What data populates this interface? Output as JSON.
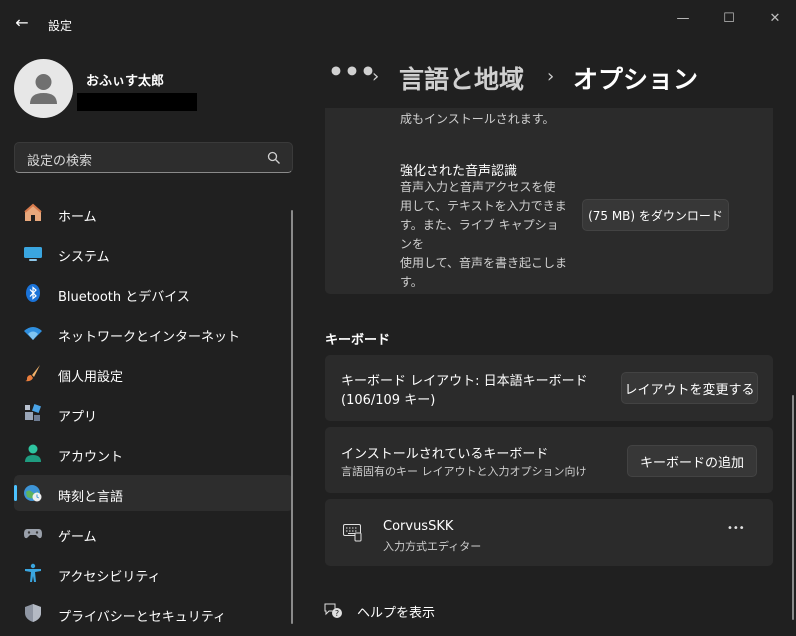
{
  "window": {
    "title": "設定",
    "back_glyph": "←",
    "minimize_glyph": "—",
    "maximize_glyph": "☐",
    "close_glyph": "✕"
  },
  "profile": {
    "name": "おふぃす太郎"
  },
  "search": {
    "placeholder": "設定の検索"
  },
  "sidebar": {
    "items": [
      {
        "label": "ホーム",
        "icon": "home-icon"
      },
      {
        "label": "システム",
        "icon": "system-icon"
      },
      {
        "label": "Bluetooth とデバイス",
        "icon": "bluetooth-icon"
      },
      {
        "label": "ネットワークとインターネット",
        "icon": "wifi-icon"
      },
      {
        "label": "個人用設定",
        "icon": "brush-icon"
      },
      {
        "label": "アプリ",
        "icon": "apps-icon"
      },
      {
        "label": "アカウント",
        "icon": "account-icon"
      },
      {
        "label": "時刻と言語",
        "icon": "time-language-icon",
        "selected": true
      },
      {
        "label": "ゲーム",
        "icon": "gamepad-icon"
      },
      {
        "label": "アクセシビリティ",
        "icon": "accessibility-icon"
      },
      {
        "label": "プライバシーとセキュリティ",
        "icon": "shield-icon"
      }
    ]
  },
  "breadcrumb": {
    "more": "•••",
    "sep": "›",
    "parent": "言語と地域",
    "current": "オプション"
  },
  "content": {
    "top_partial_text": "成もインストールされます。",
    "speech": {
      "title": "強化された音声認識",
      "line1": "音声入力と音声アクセスを使",
      "line2": "用して、テキストを入力できま",
      "line3": "す。また、ライブ キャプションを",
      "line4": "使用して、音声を書き起こしま",
      "line5": "す。",
      "button": "(75 MB) をダウンロード"
    },
    "keyboard_section": "キーボード",
    "layout": {
      "title_line1": "キーボード レイアウト: 日本語キーボード",
      "title_line2": "(106/109 キー)",
      "button": "レイアウトを変更する"
    },
    "installed": {
      "title": "インストールされているキーボード",
      "subtitle": "言語固有のキー レイアウトと入力オプション向け",
      "button": "キーボードの追加"
    },
    "ime": {
      "name": "CorvusSKK",
      "subtitle": "入力方式エディター",
      "more": "•••"
    },
    "help": "ヘルプを表示"
  },
  "colors": {
    "background": "#202020",
    "card": "#2b2b2b",
    "accent": "#4cc2ff"
  }
}
